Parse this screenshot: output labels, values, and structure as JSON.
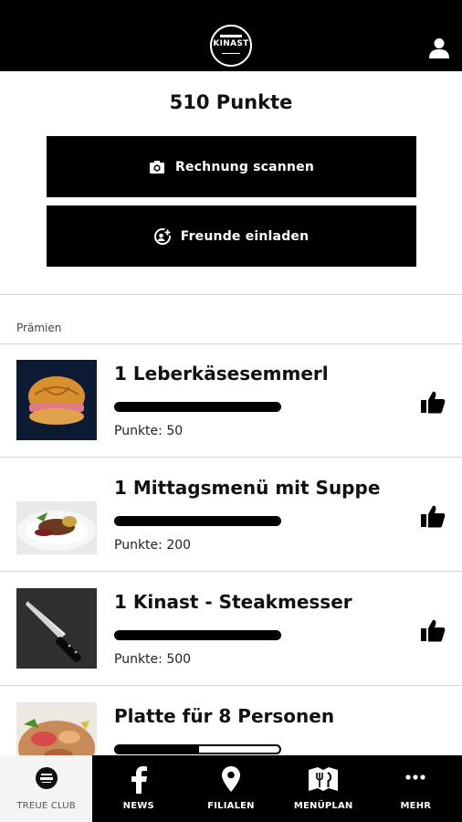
{
  "header": {
    "logo_text": "KINAST",
    "user_icon": "user-icon"
  },
  "points": {
    "label": "510 Punkte"
  },
  "actions": {
    "scan_label": "Rechnung scannen",
    "invite_label": "Freunde einladen"
  },
  "section": {
    "label": "Prämien"
  },
  "rewards": [
    {
      "title": "1 Leberkäsesemmerl",
      "points": "Punkte: 50",
      "progress": 1.0,
      "image": "leberkaese-semmel"
    },
    {
      "title": "1 Mittagsmenü mit Suppe",
      "points": "Punkte: 200",
      "progress": 1.0,
      "image": "mittagsmenue-plate"
    },
    {
      "title": "1 Kinast - Steakmesser",
      "points": "Punkte: 500",
      "progress": 1.0,
      "image": "steak-knife"
    },
    {
      "title": "Platte für 8 Personen",
      "points": "",
      "progress": 0.51,
      "image": "platter"
    }
  ],
  "tabs": [
    {
      "label": "TREUE CLUB",
      "icon": "treue-club-logo-icon",
      "active": true
    },
    {
      "label": "NEWS",
      "icon": "facebook-icon",
      "active": false
    },
    {
      "label": "FILIALEN",
      "icon": "map-pin-icon",
      "active": false
    },
    {
      "label": "MENÜPLAN",
      "icon": "cutlery-icon",
      "active": false
    },
    {
      "label": "MEHR",
      "icon": "more-dots-icon",
      "active": false
    }
  ]
}
